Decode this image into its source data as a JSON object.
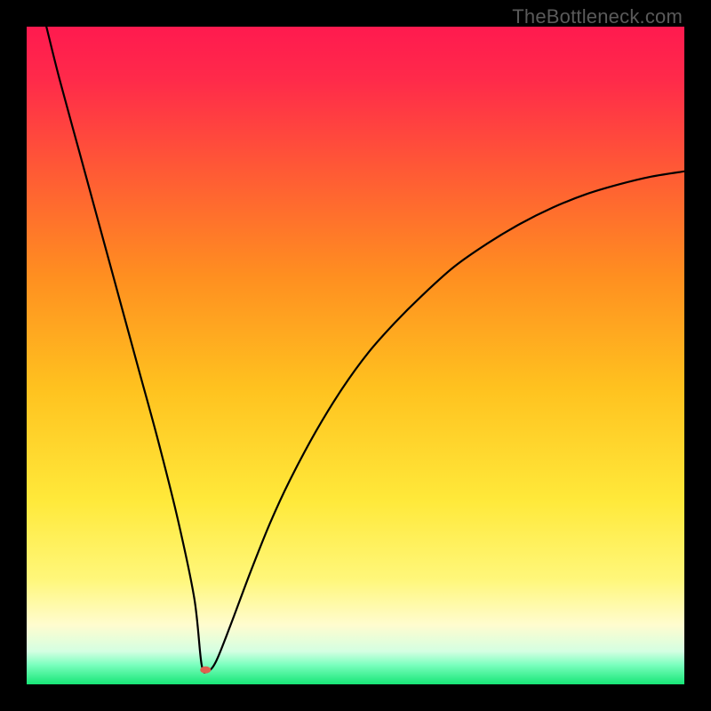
{
  "watermark": "TheBottleneck.com",
  "chart_data": {
    "type": "line",
    "title": "",
    "xlabel": "",
    "ylabel": "",
    "xlim": [
      0,
      100
    ],
    "ylim": [
      0,
      100
    ],
    "grid": false,
    "legend": false,
    "background_gradient": {
      "top_color": "#ff1a4f",
      "mid_colors": [
        "#ff6a2a",
        "#ffc21f",
        "#ffe93a",
        "#fffacd"
      ],
      "bottom_color": "#17e676"
    },
    "series": [
      {
        "name": "bottleneck-curve",
        "color": "#000000",
        "x": [
          3.0,
          5,
          8,
          11,
          14,
          17,
          20,
          23,
          25.5,
          26.6,
          27.5,
          28.8,
          31,
          34,
          37,
          40,
          44,
          48,
          52,
          56,
          60,
          65,
          70,
          75,
          80,
          85,
          90,
          95,
          100
        ],
        "y": [
          100,
          92,
          81,
          70,
          59,
          48,
          37,
          25,
          13,
          3.0,
          2.0,
          3.5,
          9,
          17,
          24.5,
          31,
          38.5,
          45,
          50.5,
          55,
          59,
          63.5,
          67,
          70,
          72.5,
          74.5,
          76,
          77.2,
          78
        ]
      }
    ],
    "marker": {
      "name": "optimal-point",
      "x": 27.2,
      "y": 2.2,
      "color": "#e0604f",
      "rx": 6,
      "ry": 4
    }
  }
}
